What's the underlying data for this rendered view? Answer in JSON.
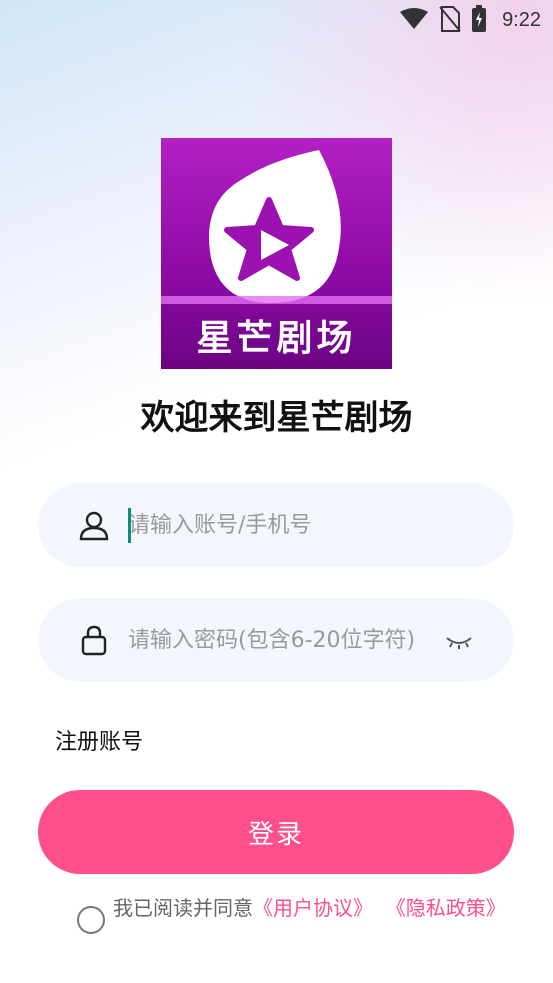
{
  "status_bar": {
    "time": "9:22",
    "icons": [
      "wifi-icon",
      "no-sim-icon",
      "battery-charging-icon"
    ]
  },
  "app": {
    "logo_text": "星芒剧场",
    "welcome": "欢迎来到星芒剧场"
  },
  "form": {
    "account_placeholder": "请输入账号/手机号",
    "password_placeholder": "请输入密码(包含6-20位字符)",
    "register_label": "注册账号",
    "login_label": "登录"
  },
  "agreement": {
    "prefix": "我已阅读并同意",
    "user_agreement": "《用户协议》",
    "privacy_policy": "《隐私政策》"
  },
  "colors": {
    "accent": "#ff4f8d",
    "logo_purple": "#9b12b0"
  }
}
